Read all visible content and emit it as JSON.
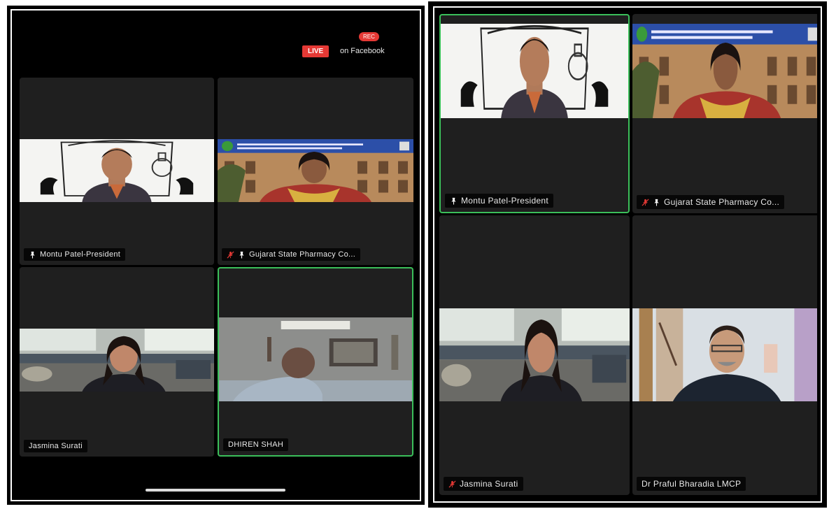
{
  "left_screen": {
    "rec_label": "REC",
    "live_label": "LIVE",
    "live_text": "on Facebook",
    "participants": [
      {
        "name": "Montu Patel-President",
        "pinned": true,
        "muted": false,
        "active": false
      },
      {
        "name": "Gujarat State Pharmacy Co...",
        "pinned": true,
        "muted": true,
        "active": false
      },
      {
        "name": "Jasmina Surati",
        "pinned": false,
        "muted": false,
        "active": false
      },
      {
        "name": "DHIREN SHAH",
        "pinned": false,
        "muted": false,
        "active": true
      }
    ]
  },
  "right_screen": {
    "participants": [
      {
        "name": "Montu Patel-President",
        "pinned": true,
        "muted": false,
        "active": true
      },
      {
        "name": "Gujarat State Pharmacy Co...",
        "pinned": true,
        "muted": true,
        "active": false
      },
      {
        "name": "Jasmina Surati",
        "pinned": false,
        "muted": true,
        "active": false
      },
      {
        "name": "Dr Praful Bharadia LMCP",
        "pinned": false,
        "muted": false,
        "active": false
      }
    ]
  },
  "icons": {
    "pin": "pin-icon",
    "mute": "mic-muted-icon",
    "active_speaker_color": "#3bbf5a",
    "live_color": "#e53935"
  }
}
